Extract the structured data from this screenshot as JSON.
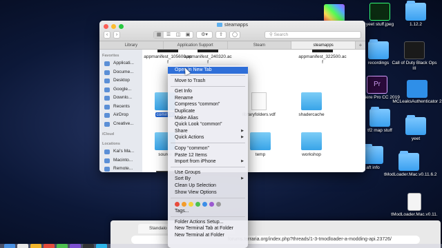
{
  "desktop": {
    "icons": [
      {
        "label": "",
        "kind": "image"
      },
      {
        "label": "yeet stuff.jpeg",
        "kind": "image"
      },
      {
        "label": "1.12.2",
        "kind": "folder"
      },
      {
        "label": "recordings",
        "kind": "folder"
      },
      {
        "label": "Call of Duty Black Ops III",
        "kind": "app"
      },
      {
        "label": "Premiere Pro CC 2019",
        "kind": "app"
      },
      {
        "label": "MCLeaksAuthenticator 2",
        "kind": "app"
      },
      {
        "label": "tf2 map stuff",
        "kind": "folder"
      },
      {
        "label": "yeet",
        "kind": "folder"
      },
      {
        "label": "aft info",
        "kind": "folder"
      },
      {
        "label": "tModLoader.Mac.v0.11.6.2",
        "kind": "folder"
      },
      {
        "label": "tModLoader.Mac.v0.11.",
        "kind": "zip"
      }
    ]
  },
  "finder": {
    "title": "steamapps",
    "search_placeholder": "Search",
    "tabs": [
      "Library",
      "Application Support",
      "Steam",
      "steamapps"
    ],
    "active_tab": 3,
    "sidebar": {
      "favorites_header": "Favorites",
      "favorites": [
        "Applicati...",
        "Docume...",
        "Desktop",
        "Google...",
        "Downlo...",
        "Recents",
        "AirDrop",
        "Creative..."
      ],
      "icloud_header": "iCloud",
      "locations_header": "Locations",
      "locations": [
        "Kai's Ma...",
        "Macinto...",
        "Remote..."
      ]
    },
    "files": [
      {
        "name": "appmanifest_105600.acf",
        "icon": "dark"
      },
      {
        "name": "appmanifest_240320.acf",
        "icon": "dark"
      },
      {
        "name": "appmanifest_322500.acf",
        "icon": "dark"
      },
      {
        "name": "common",
        "icon": "blue",
        "selected": true
      },
      {
        "name": "libraryfolders.vdf",
        "icon": "doc"
      },
      {
        "name": "shadercache",
        "icon": "blue"
      },
      {
        "name": "source",
        "icon": "blue"
      },
      {
        "name": "temp",
        "icon": "blue"
      },
      {
        "name": "workshop",
        "icon": "blue"
      },
      {
        "name": "",
        "icon": "term"
      }
    ]
  },
  "context_menu": {
    "group1": [
      "Open in New Tab"
    ],
    "group2": [
      "Move to Trash"
    ],
    "group3": [
      "Get Info",
      "Rename",
      "Compress “common”",
      "Duplicate",
      "Make Alias",
      "Quick Look “common”",
      "Share",
      "Quick Actions"
    ],
    "group4": [
      "Copy “common”",
      "Paste 12 Items",
      "Import from iPhone"
    ],
    "group5": [
      "Use Groups",
      "Sort By",
      "Clean Up Selection",
      "Show View Options"
    ],
    "tag_colors": [
      "#e84b3c",
      "#f39c2b",
      "#f3d23a",
      "#4cc04e",
      "#3b8ee8",
      "#9b59d0",
      "#9a9a9a"
    ],
    "group6": [
      "Tags..."
    ],
    "group7": [
      "Folder Actions Setup...",
      "New Terminal Tab at Folder",
      "New Terminal at Folder"
    ]
  },
  "browser": {
    "tab_title": "Standalo",
    "url": "forums.terraria.org/index.php?threads/1-3-tmodloader-a-modding-api.23726/"
  },
  "colors": {
    "accent": "#2f6fd8",
    "folder": "#38a4e8"
  }
}
